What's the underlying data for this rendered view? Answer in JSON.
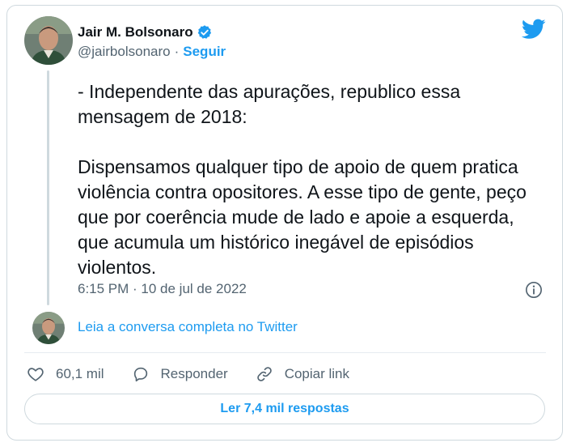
{
  "author": {
    "display_name": "Jair M. Bolsonaro",
    "handle": "@jairbolsonaro",
    "separator": "·",
    "follow_label": "Seguir",
    "verified": true
  },
  "tweet": {
    "text": "- Independente das apurações, republico essa mensagem de 2018:\n\nDispensamos qualquer tipo de apoio de quem pratica violência contra opositores. A esse tipo de gente, peço que por coerência mude de lado e apoie a esquerda, que acumula um histórico inegável de episódios violentos.",
    "timestamp": "6:15 PM · 10 de jul de 2022"
  },
  "thread": {
    "read_full_label": "Leia a conversa completa no Twitter"
  },
  "actions": {
    "like_count": "60,1 mil",
    "reply_label": "Responder",
    "copy_link_label": "Copiar link"
  },
  "footer": {
    "read_replies_label": "Ler 7,4 mil respostas"
  },
  "colors": {
    "accent": "#1d9bf0",
    "text": "#0f1419",
    "muted": "#536471",
    "border": "#cfd9de"
  },
  "icons": {
    "brand": "twitter-bird-icon",
    "verified": "verified-badge-icon",
    "info": "info-icon",
    "like": "heart-icon",
    "reply": "speech-bubble-icon",
    "copy": "link-icon"
  }
}
